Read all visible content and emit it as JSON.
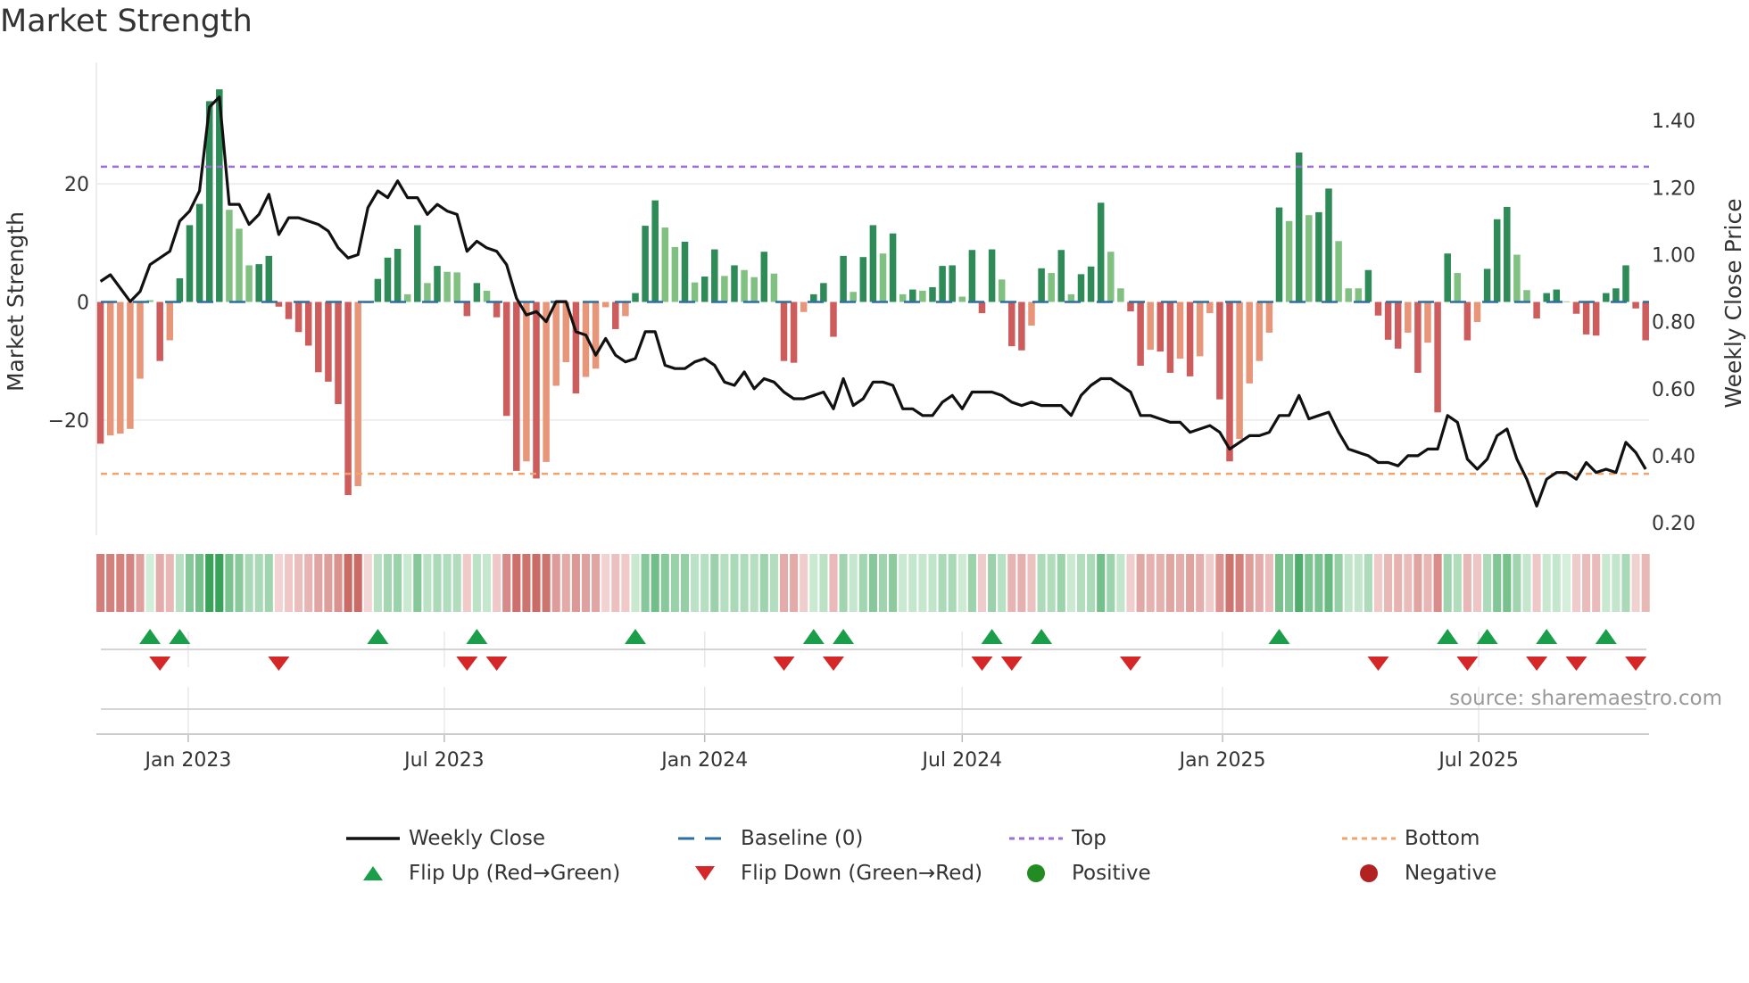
{
  "chart_data": {
    "type": "bar",
    "title": "Market Strength",
    "ylabel": "Market Strength",
    "ylabel_right": "Weekly Close Price",
    "ylim": [
      -39.5,
      39.8
    ],
    "ylim_right": [
      0.163,
      1.56
    ],
    "y_ticks": [
      {
        "value": 20,
        "label": "20"
      },
      {
        "value": 0,
        "label": "0"
      },
      {
        "value": -20,
        "label": "−20"
      }
    ],
    "y_ticks_right": [
      {
        "value": 1.4,
        "label": "1.40"
      },
      {
        "value": 1.2,
        "label": "1.20"
      },
      {
        "value": 1.0,
        "label": "1.00"
      },
      {
        "value": 0.8,
        "label": "0.80"
      },
      {
        "value": 0.6,
        "label": "0.60"
      },
      {
        "value": 0.4,
        "label": "0.40"
      },
      {
        "value": 0.2,
        "label": "0.20"
      }
    ],
    "x_start_week": "2022-10-31",
    "x_ticks": [
      {
        "date": "2023-01-01",
        "label": "Jan 2023"
      },
      {
        "date": "2023-07-01",
        "label": "Jul 2023"
      },
      {
        "date": "2024-01-01",
        "label": "Jan 2024"
      },
      {
        "date": "2024-07-01",
        "label": "Jul 2024"
      },
      {
        "date": "2025-01-01",
        "label": "Jan 2025"
      },
      {
        "date": "2025-07-01",
        "label": "Jul 2025"
      }
    ],
    "grid": true,
    "top_level": 22.9,
    "bottom_level": -29.1,
    "baseline": 0,
    "strength": [
      -24,
      -22.6,
      -22.3,
      -21.5,
      -13,
      0.3,
      -10,
      -6.5,
      4,
      13,
      16.6,
      34,
      36,
      15.6,
      12.4,
      6.2,
      6.4,
      7.8,
      -0.8,
      -2.9,
      -5.1,
      -7.4,
      -11.9,
      -13.5,
      -17.3,
      -32.7,
      -31.2,
      -0.2,
      3.9,
      7.5,
      9,
      1.3,
      13,
      3.2,
      6.1,
      5.1,
      5,
      -2.4,
      3.2,
      1.9,
      -2.6,
      -19.3,
      -28.6,
      -27,
      -29.9,
      -27.1,
      -14.2,
      -10.2,
      -15.5,
      -12.7,
      -11.3,
      -0.9,
      -4.6,
      -2.4,
      1.5,
      12.9,
      17.2,
      12.6,
      9.3,
      10.2,
      3.3,
      4.3,
      8.9,
      4.4,
      6.2,
      5.4,
      4.2,
      8.5,
      4.8,
      -10,
      -10.3,
      -1.7,
      1.3,
      3.2,
      -5.9,
      7.8,
      1.7,
      7.6,
      13,
      8.2,
      11.6,
      1.3,
      2.1,
      1.9,
      2.5,
      6.1,
      6.2,
      0.9,
      8.8,
      -1.9,
      8.9,
      3.8,
      -7.5,
      -8.2,
      -4,
      5.7,
      4.9,
      8.8,
      1.3,
      4.7,
      6,
      16.8,
      8.5,
      2.3,
      -1.6,
      -10.8,
      -8.1,
      -8.4,
      -12,
      -9.6,
      -12.6,
      -9.2,
      -1.9,
      -16.5,
      -27,
      -23.2,
      -13.8,
      -10,
      -5.2,
      16,
      13.7,
      25.3,
      14.7,
      15.2,
      19.2,
      10.3,
      2.3,
      2.3,
      5.4,
      -2.3,
      -6.4,
      -7.9,
      -5.2,
      -12,
      -6.9,
      -18.7,
      8.2,
      4.9,
      -6.5,
      -3.4,
      5.6,
      14,
      16.1,
      8,
      2,
      -2.8,
      1.5,
      2.1,
      0.1,
      -2,
      -5.5,
      -5.7,
      1.5,
      2.3,
      6.2,
      -1.1,
      -6.5
    ],
    "strength_strong": [
      1,
      0,
      0,
      0,
      0,
      0,
      1,
      0,
      1,
      1,
      1,
      1,
      1,
      0,
      0,
      0,
      1,
      1,
      1,
      1,
      1,
      1,
      1,
      1,
      1,
      1,
      0,
      0,
      1,
      1,
      1,
      0,
      1,
      0,
      1,
      0,
      0,
      1,
      1,
      0,
      1,
      1,
      1,
      0,
      1,
      0,
      0,
      0,
      1,
      0,
      0,
      0,
      1,
      0,
      1,
      1,
      1,
      0,
      0,
      1,
      0,
      1,
      1,
      0,
      1,
      0,
      0,
      1,
      0,
      1,
      1,
      0,
      1,
      1,
      1,
      1,
      0,
      1,
      1,
      0,
      1,
      0,
      1,
      0,
      1,
      1,
      1,
      0,
      1,
      1,
      1,
      0,
      1,
      1,
      0,
      1,
      0,
      1,
      0,
      1,
      1,
      1,
      0,
      0,
      1,
      1,
      0,
      1,
      1,
      0,
      1,
      0,
      0,
      1,
      1,
      0,
      0,
      0,
      0,
      1,
      0,
      1,
      0,
      1,
      1,
      0,
      0,
      0,
      1,
      1,
      1,
      1,
      0,
      1,
      0,
      1,
      1,
      0,
      1,
      0,
      1,
      1,
      1,
      0,
      0,
      1,
      1,
      1,
      0,
      1,
      1,
      1,
      1,
      1,
      1,
      1,
      1
    ],
    "weekly_close": [
      0.92,
      0.94,
      0.9,
      0.86,
      0.89,
      0.97,
      0.99,
      1.01,
      1.1,
      1.13,
      1.19,
      1.44,
      1.47,
      1.15,
      1.15,
      1.09,
      1.12,
      1.18,
      1.06,
      1.11,
      1.11,
      1.1,
      1.09,
      1.07,
      1.02,
      0.99,
      1.0,
      1.14,
      1.19,
      1.17,
      1.22,
      1.17,
      1.17,
      1.12,
      1.15,
      1.13,
      1.12,
      1.01,
      1.04,
      1.02,
      1.01,
      0.97,
      0.87,
      0.82,
      0.83,
      0.8,
      0.86,
      0.86,
      0.77,
      0.76,
      0.7,
      0.75,
      0.7,
      0.68,
      0.69,
      0.77,
      0.77,
      0.67,
      0.66,
      0.66,
      0.68,
      0.69,
      0.67,
      0.62,
      0.61,
      0.65,
      0.6,
      0.63,
      0.62,
      0.59,
      0.57,
      0.57,
      0.58,
      0.59,
      0.54,
      0.63,
      0.55,
      0.57,
      0.62,
      0.62,
      0.61,
      0.54,
      0.54,
      0.52,
      0.52,
      0.56,
      0.58,
      0.54,
      0.59,
      0.59,
      0.59,
      0.58,
      0.56,
      0.55,
      0.56,
      0.55,
      0.55,
      0.55,
      0.52,
      0.58,
      0.61,
      0.63,
      0.63,
      0.61,
      0.59,
      0.52,
      0.52,
      0.51,
      0.5,
      0.5,
      0.47,
      0.48,
      0.49,
      0.47,
      0.42,
      0.44,
      0.46,
      0.46,
      0.47,
      0.52,
      0.52,
      0.58,
      0.51,
      0.52,
      0.53,
      0.47,
      0.42,
      0.41,
      0.4,
      0.38,
      0.38,
      0.37,
      0.4,
      0.4,
      0.42,
      0.42,
      0.52,
      0.5,
      0.39,
      0.36,
      0.39,
      0.46,
      0.48,
      0.39,
      0.33,
      0.25,
      0.33,
      0.35,
      0.35,
      0.33,
      0.38,
      0.35,
      0.36,
      0.35,
      0.44,
      0.41,
      0.36
    ],
    "legend": [
      {
        "key": "weekly_close",
        "label": "Weekly Close"
      },
      {
        "key": "baseline",
        "label": "Baseline (0)"
      },
      {
        "key": "top",
        "label": "Top"
      },
      {
        "key": "bottom",
        "label": "Bottom"
      },
      {
        "key": "flip_up",
        "label": "Flip Up (Red→Green)"
      },
      {
        "key": "flip_down",
        "label": "Flip Down (Green→Red)"
      },
      {
        "key": "positive",
        "label": "Positive"
      },
      {
        "key": "negative",
        "label": "Negative"
      }
    ],
    "legend_position": "bottom",
    "colors": {
      "pos_strong": "#2e8b57",
      "pos_weak": "#80c080",
      "neg_strong": "#cd5c5c",
      "neg_weak": "#e8967a",
      "line": "#111111",
      "baseline": "#2f6f9f",
      "top": "#9b6fd6",
      "bottom": "#f0a36a",
      "flip_up": "#1a9e4a",
      "flip_down": "#d62728",
      "positive": "#228b22",
      "negative": "#b22222"
    },
    "annotation": "source: sharemaestro.com"
  }
}
